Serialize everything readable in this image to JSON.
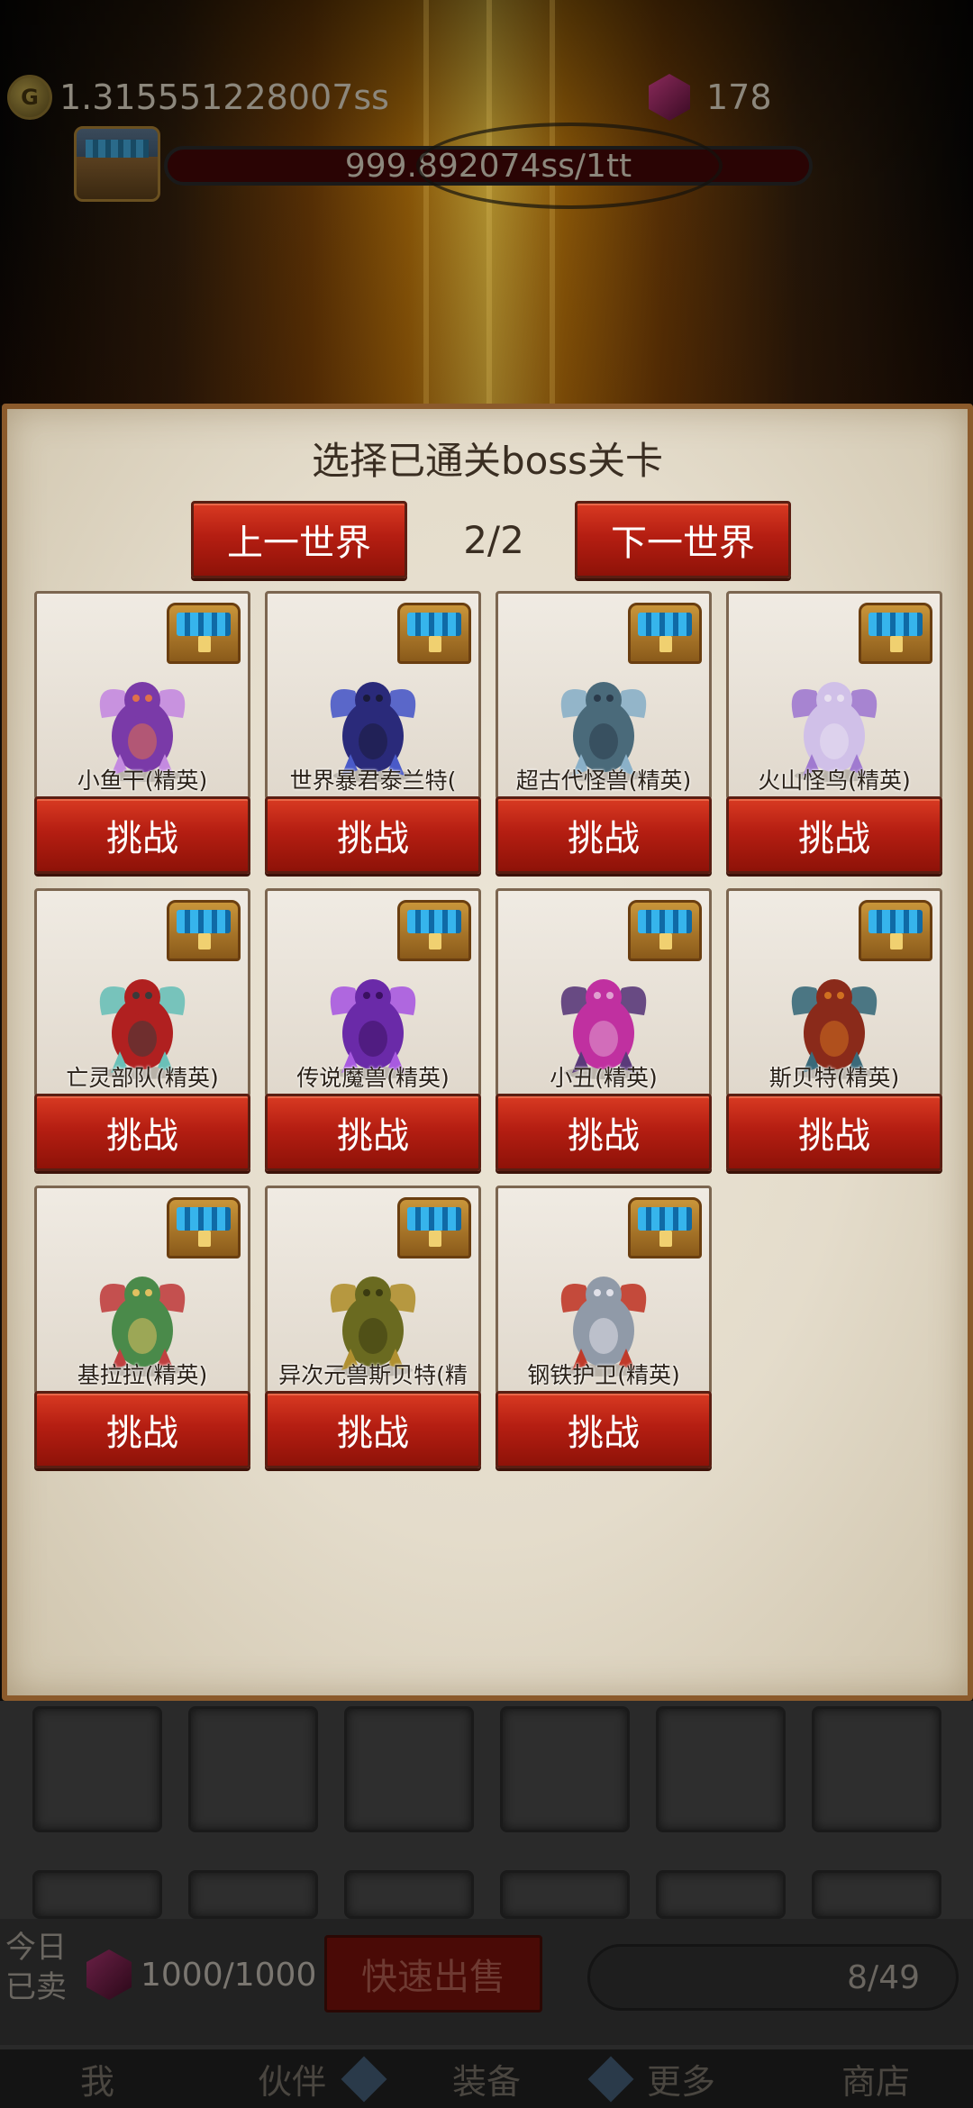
{
  "top_bar": {
    "gold_icon_label": "G",
    "gold_amount": "1.31555122800​7ss",
    "gem_amount": "178",
    "boss_hp": "999.892074ss/1tt"
  },
  "dialog": {
    "title": "选择已通关boss关卡",
    "prev_world_label": "上一世界",
    "next_world_label": "下一世界",
    "page_indicator": "2/2",
    "bosses": [
      {
        "name": "小鱼干(精英)",
        "action": "挑战",
        "icon": "imp-demon-icon"
      },
      {
        "name": "世界暴君泰兰特(",
        "action": "挑战",
        "icon": "dark-dragon-icon"
      },
      {
        "name": "超古代怪兽(精英)",
        "action": "挑战",
        "icon": "shark-beast-icon"
      },
      {
        "name": "火山怪鸟(精英)",
        "action": "挑战",
        "icon": "winged-bird-icon"
      },
      {
        "name": "亡灵部队(精英)",
        "action": "挑战",
        "icon": "undead-rider-icon"
      },
      {
        "name": "传说魔兽(精英)",
        "action": "挑战",
        "icon": "purple-demon-icon"
      },
      {
        "name": "小丑(精英)",
        "action": "挑战",
        "icon": "clown-icon"
      },
      {
        "name": "斯贝特(精英)",
        "action": "挑战",
        "icon": "horned-behemoth-icon"
      },
      {
        "name": "基拉拉(精英)",
        "action": "挑战",
        "icon": "green-dragon-icon"
      },
      {
        "name": "异次元兽斯贝特(精",
        "action": "挑战",
        "icon": "golden-beast-icon"
      },
      {
        "name": "钢铁护卫(精英)",
        "action": "挑战",
        "icon": "armored-knight-icon"
      }
    ]
  },
  "bottom": {
    "sold_today_label_line1": "今日",
    "sold_today_label_line2": "已卖",
    "sold_count": "1000/1000",
    "quick_sell_label": "快速出售",
    "capacity": "8/49",
    "nav": [
      "我",
      "伙伴",
      "装备",
      "更多",
      "商店"
    ]
  },
  "colors": {
    "button_red": "#b51e12",
    "dialog_border": "#8b5a2b",
    "dialog_bg": "#e4dccb"
  }
}
